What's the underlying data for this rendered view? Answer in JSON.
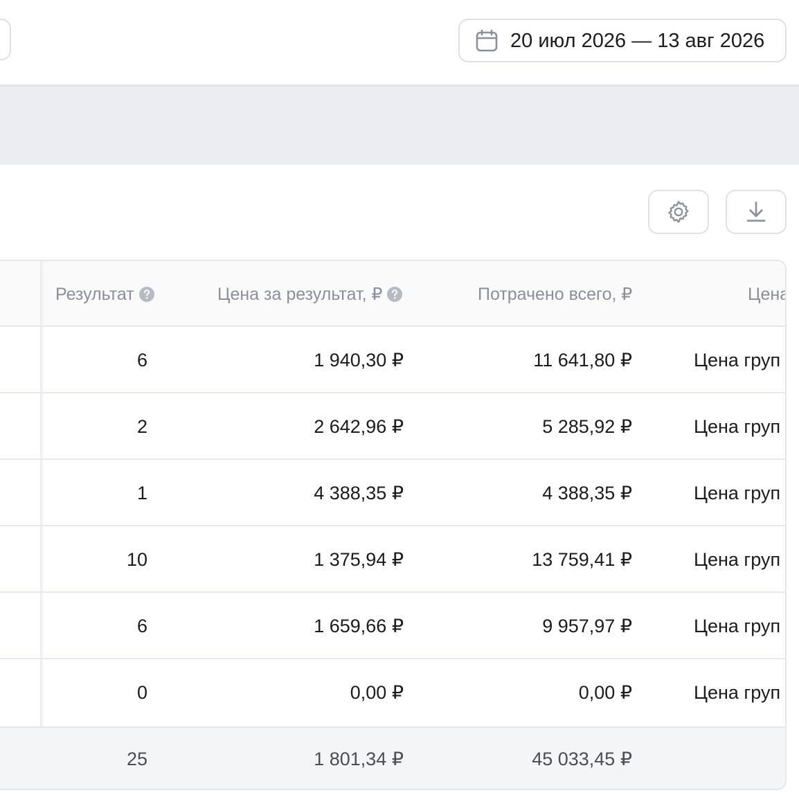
{
  "header": {
    "date_range": "20 июл 2026 — 13 авг 2026"
  },
  "toolbar": {
    "settings_icon": "gear-icon",
    "download_icon": "download-icon"
  },
  "table": {
    "columns": {
      "result": "Результат",
      "price_per_result": "Цена за результат, ₽",
      "spent_total": "Потрачено всего, ₽",
      "bid": "Цена"
    },
    "rows": [
      {
        "result": "6",
        "price": "1 940,30 ₽",
        "spent": "11 641,80 ₽",
        "bid": "Цена груп"
      },
      {
        "result": "2",
        "price": "2 642,96 ₽",
        "spent": "5 285,92 ₽",
        "bid": "Цена груп"
      },
      {
        "result": "1",
        "price": "4 388,35 ₽",
        "spent": "4 388,35 ₽",
        "bid": "Цена груп"
      },
      {
        "result": "10",
        "price": "1 375,94 ₽",
        "spent": "13 759,41 ₽",
        "bid": "Цена груп"
      },
      {
        "result": "6",
        "price": "1 659,66 ₽",
        "spent": "9 957,97 ₽",
        "bid": "Цена груп"
      },
      {
        "result": "0",
        "price": "0,00 ₽",
        "spent": "0,00 ₽",
        "bid": "Цена груп"
      }
    ],
    "totals": {
      "result": "25",
      "price": "1 801,34 ₽",
      "spent": "45 033,45 ₽"
    }
  },
  "colors": {
    "border": "#dfe1e5",
    "header_text": "#8a8f99",
    "band": "#ebedf0",
    "footer_bg": "#f4f5f7"
  }
}
